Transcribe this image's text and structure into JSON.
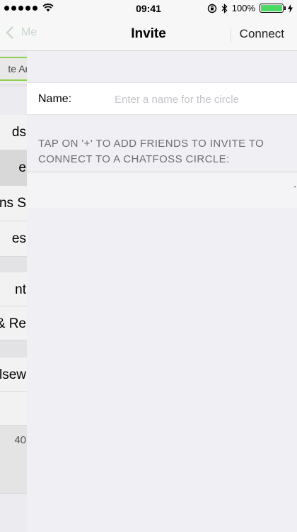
{
  "status_bar": {
    "time": "09:41",
    "battery_text": "100%",
    "battery_level": 1.0
  },
  "nav": {
    "back_label": "Me",
    "title": "Invite",
    "action_label": "Connect"
  },
  "background_menu": {
    "tab_label": "te Are",
    "items": [
      {
        "label": "ds"
      },
      {
        "label": "e"
      },
      {
        "label": "ns S"
      },
      {
        "label": "es"
      },
      {
        "label": "nt"
      },
      {
        "label": "& Re"
      },
      {
        "label": "lsew"
      },
      {
        "label": ""
      },
      {
        "label": "40"
      }
    ]
  },
  "form": {
    "name_label": "Name:",
    "name_value": "",
    "name_placeholder": "Enter a name for the circle",
    "instructions": "TAP ON '+' TO ADD FRIENDS TO INVITE TO CONNECT TO A CHATFOSS CIRCLE:",
    "list_marker": "'"
  },
  "colors": {
    "accent_green": "#8fd14f",
    "battery_green": "#4cd964",
    "placeholder_gray": "#c4c4c9"
  }
}
